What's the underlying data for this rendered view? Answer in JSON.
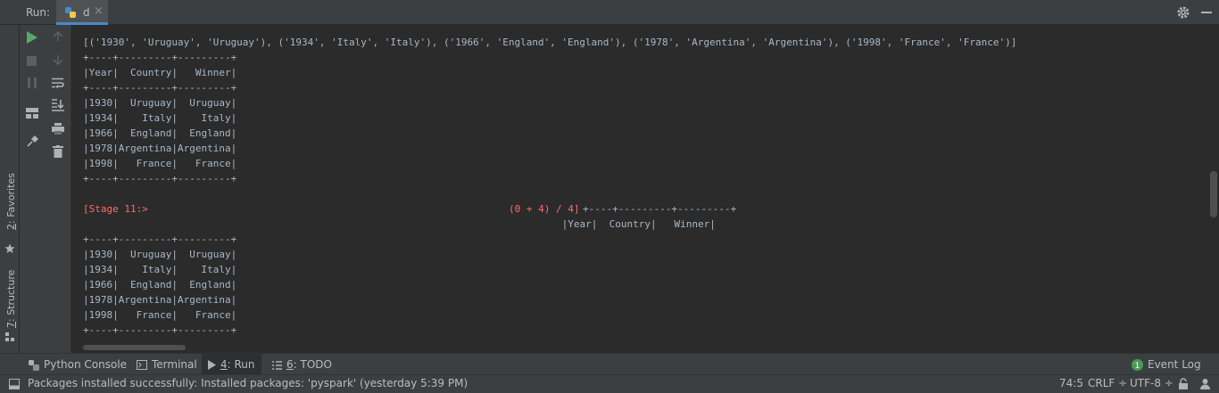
{
  "header": {
    "run_label": "Run:",
    "tab_name": "d",
    "tab_close": "×"
  },
  "left_strip": {
    "favorites": {
      "num": "2",
      "label": ": Favorites"
    },
    "structure": {
      "num": "7",
      "label": ": Structure"
    }
  },
  "console": {
    "lines": [
      "[('1930', 'Uruguay', 'Uruguay'), ('1934', 'Italy', 'Italy'), ('1966', 'England', 'England'), ('1978', 'Argentina', 'Argentina'), ('1998', 'France', 'France')]",
      "+----+---------+---------+",
      "|Year|  Country|   Winner|",
      "+----+---------+---------+",
      "|1930|  Uruguay|  Uruguay|",
      "|1934|    Italy|    Italy|",
      "|1966|  England|  England|",
      "|1978|Argentina|Argentina|",
      "|1998|   France|   France|",
      "+----+---------+---------+",
      "",
      "",
      "                                                                                   |Year|  Country|   Winner|",
      "+----+---------+---------+",
      "|1930|  Uruguay|  Uruguay|",
      "|1934|    Italy|    Italy|",
      "|1966|  England|  England|",
      "|1978|Argentina|Argentina|",
      "|1998|   France|   France|",
      "+----+---------+---------+"
    ],
    "stage_label": "[Stage 11:>",
    "stage_progress": "(0 + 4) / 4]",
    "stage_tail": "+----+---------+---------+"
  },
  "tool_tabs": {
    "python_console": "Python Console",
    "terminal": "Terminal",
    "run_num": "4",
    "run_label": ": Run",
    "todo_num": "6",
    "todo_label": ": TODO",
    "event_log": "Event Log",
    "event_count": "1"
  },
  "status": {
    "message": "Packages installed successfully: Installed packages: 'pyspark' (yesterday 5:39 PM)",
    "position": "74:5",
    "line_sep": "CRLF ÷",
    "encoding": "UTF-8 ÷"
  },
  "colors": {
    "run_green": "#59a869",
    "error_red": "#ff6b68",
    "console_text": "#a9b7c6"
  }
}
